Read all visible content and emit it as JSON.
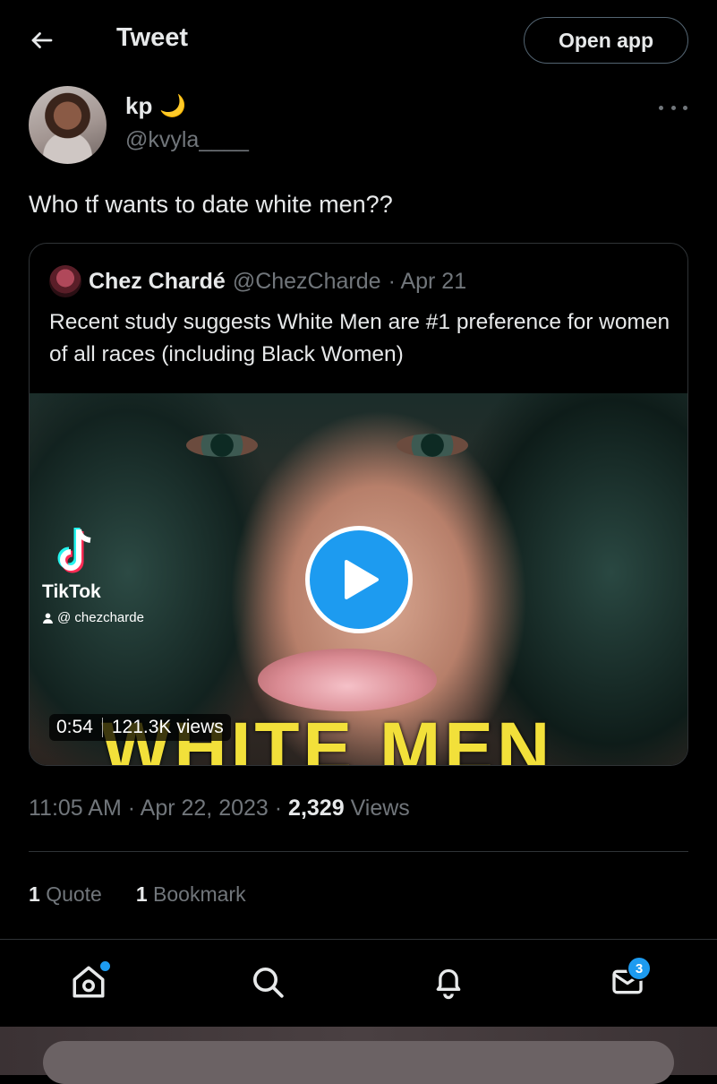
{
  "header": {
    "title": "Tweet",
    "open_app_label": "Open app"
  },
  "tweet": {
    "author": {
      "name": "kp",
      "emoji": "🌙",
      "handle": "@kvyla____"
    },
    "text": "Who tf wants to date white men??",
    "quoted": {
      "name": "Chez Chardé",
      "handle": "@ChezCharde",
      "date": "· Apr 21",
      "text": "Recent study suggests White Men are #1 preference for women of all races (including Black Women)",
      "media": {
        "overlay_text": "WHITE MEN",
        "tiktok_label": "TikTok",
        "tiktok_user": "@ chezcharde",
        "duration": "0:54",
        "views": "121.3K views"
      }
    },
    "time": "11:05 AM",
    "date": "Apr 22, 2023",
    "views_count": "2,329",
    "views_label": "Views",
    "quotes_count": "1",
    "quotes_label": "Quote",
    "bookmarks_count": "1",
    "bookmarks_label": "Bookmark"
  },
  "nav": {
    "messages_badge": "3",
    "accent": "#1d9bf0"
  }
}
